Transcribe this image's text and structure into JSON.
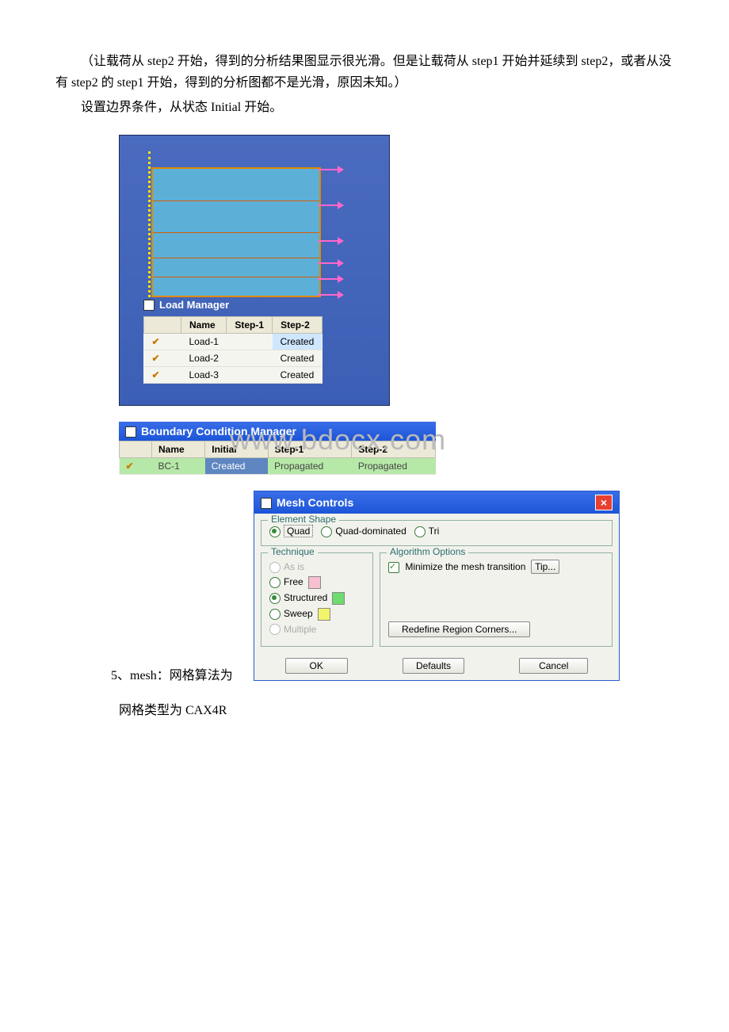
{
  "para": {
    "p1": "（让载荷从 step2 开始，得到的分析结果图显示很光滑。但是让载荷从 step1 开始并延续到 step2，或者从没有 step2 的 step1 开始，得到的分析图都不是光滑，原因未知。）",
    "p2": "设置边界条件，从状态 Initial 开始。",
    "line5_prefix": "5、mesh：网格算法为",
    "line6": "网格类型为 CAX4R"
  },
  "watermark": "www.bdocx.com",
  "load_manager": {
    "title": "Load Manager",
    "h_name": "Name",
    "h_step1": "Step-1",
    "h_step2": "Step-2",
    "rows": [
      {
        "name": "Load-1",
        "step1": "",
        "step2": "Created",
        "sel": true
      },
      {
        "name": "Load-2",
        "step1": "",
        "step2": "Created"
      },
      {
        "name": "Load-3",
        "step1": "",
        "step2": "Created"
      }
    ]
  },
  "bc_manager": {
    "title": "Boundary Condition Manager",
    "h_name": "Name",
    "h_initial": "Initial",
    "h_step1": "Step-1",
    "h_step2": "Step-2",
    "row": {
      "name": "BC-1",
      "initial": "Created",
      "step1": "Propagated",
      "step2": "Propagated"
    }
  },
  "mesh_controls": {
    "title": "Mesh Controls",
    "element_shape": "Element Shape",
    "quad": "Quad",
    "quad_dom": "Quad-dominated",
    "tri": "Tri",
    "technique": "Technique",
    "as_is": "As is",
    "free": "Free",
    "structured": "Structured",
    "sweep": "Sweep",
    "multiple": "Multiple",
    "algo": "Algorithm Options",
    "minimize": "Minimize the mesh transition",
    "tip": "Tip...",
    "redefine": "Redefine Region Corners...",
    "ok": "OK",
    "defaults": "Defaults",
    "cancel": "Cancel"
  }
}
